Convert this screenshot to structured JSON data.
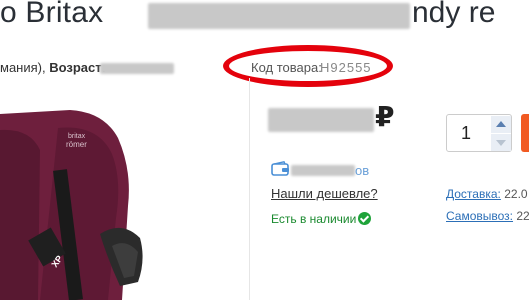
{
  "product": {
    "title_start": "о Britax",
    "title_end": "ndy re"
  },
  "specs": {
    "text_start": "мания), ",
    "age_label": "Возраст:"
  },
  "code": {
    "label": "Код товара:",
    "value": "Н92555"
  },
  "price": {
    "currency": "₽"
  },
  "quantity": {
    "value": "1"
  },
  "bonus": {
    "text_suffix": "ов"
  },
  "links": {
    "cheaper": "Нашли дешевле?"
  },
  "stock": {
    "text": "Есть в наличии"
  },
  "delivery": {
    "label": "Доставка:",
    "date": "22.0"
  },
  "pickup": {
    "label": "Самовывоз:",
    "date": "22"
  },
  "image": {
    "brand_logo_line1": "britax",
    "brand_logo_line2": "römer",
    "badge": "XP"
  },
  "colors": {
    "highlight_ring": "#e4020c",
    "stock_green": "#1fa33a",
    "link_blue": "#2c6fb7",
    "buy_button": "#f15a22",
    "seat_fabric": "#6e1f3d"
  }
}
